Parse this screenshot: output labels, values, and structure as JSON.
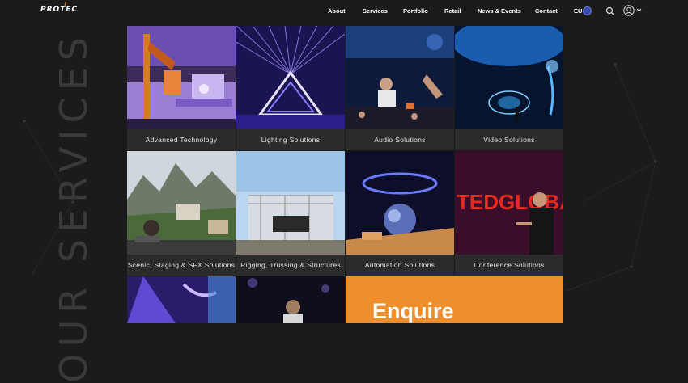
{
  "header": {
    "logo": "PROTEC",
    "nav": [
      "About",
      "Services",
      "Portfolio",
      "Retail",
      "News & Events",
      "Contact"
    ],
    "region": "EU"
  },
  "side_title": "OUR SERVICES",
  "services": [
    {
      "label": "Advanced Technology"
    },
    {
      "label": "Lighting Solutions"
    },
    {
      "label": "Audio Solutions"
    },
    {
      "label": "Video Solutions"
    },
    {
      "label": "Scenic, Staging & SFX Solutions"
    },
    {
      "label": "Rigging, Trussing & Structures"
    },
    {
      "label": "Automation Solutions"
    },
    {
      "label": "Conference Solutions"
    }
  ],
  "tedx_text": "TEDGLOBA",
  "enquire": "Enquire",
  "colors": {
    "accent": "#ef8e2a",
    "background": "#1b1b1b",
    "caption_bg": "#2b2b2b"
  }
}
